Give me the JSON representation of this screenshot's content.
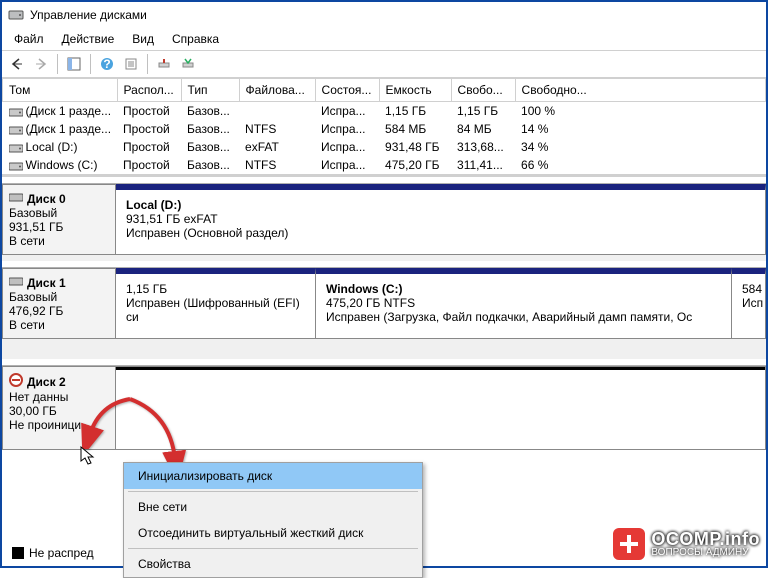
{
  "window": {
    "title": "Управление дисками"
  },
  "menu": {
    "file": "Файл",
    "action": "Действие",
    "view": "Вид",
    "help": "Справка"
  },
  "table": {
    "headers": [
      "Том",
      "Распол...",
      "Тип",
      "Файлова...",
      "Состоя...",
      "Емкость",
      "Свобо...",
      "Свободно..."
    ],
    "rows": [
      {
        "name": "(Диск 1 разде...",
        "layout": "Простой",
        "type": "Базов...",
        "fs": "",
        "status": "Испра...",
        "cap": "1,15 ГБ",
        "free": "1,15 ГБ",
        "pct": "100 %"
      },
      {
        "name": "(Диск 1 разде...",
        "layout": "Простой",
        "type": "Базов...",
        "fs": "NTFS",
        "status": "Испра...",
        "cap": "584 МБ",
        "free": "84 МБ",
        "pct": "14 %"
      },
      {
        "name": "Local (D:)",
        "layout": "Простой",
        "type": "Базов...",
        "fs": "exFAT",
        "status": "Испра...",
        "cap": "931,48 ГБ",
        "free": "313,68...",
        "pct": "34 %"
      },
      {
        "name": "Windows (C:)",
        "layout": "Простой",
        "type": "Базов...",
        "fs": "NTFS",
        "status": "Испра...",
        "cap": "475,20 ГБ",
        "free": "311,41...",
        "pct": "66 %"
      }
    ]
  },
  "disks": {
    "d0": {
      "title": "Диск 0",
      "type": "Базовый",
      "size": "931,51 ГБ",
      "status": "В сети",
      "p0": {
        "title": "Local  (D:)",
        "line2": "931,51 ГБ exFAT",
        "line3": "Исправен (Основной раздел)"
      }
    },
    "d1": {
      "title": "Диск 1",
      "type": "Базовый",
      "size": "476,92 ГБ",
      "status": "В сети",
      "p0": {
        "title": "",
        "line2": "1,15 ГБ",
        "line3": "Исправен (Шифрованный (EFI) си"
      },
      "p1": {
        "title": "Windows  (C:)",
        "line2": "475,20 ГБ NTFS",
        "line3": "Исправен (Загрузка, Файл подкачки, Аварийный дамп памяти, Ос"
      },
      "p2": {
        "title": "",
        "line2": "584",
        "line3": "Исп"
      }
    },
    "d2": {
      "title": "Диск 2",
      "type": "Нет данны",
      "size": "30,00 ГБ",
      "status": "Не проиници"
    }
  },
  "ctx": {
    "init": "Инициализировать диск",
    "offline": "Вне сети",
    "detach": "Отсоединить виртуальный жесткий диск",
    "props": "Свойства"
  },
  "legend": {
    "unallocated": "Не распред"
  },
  "brand": {
    "name": "OCOMP.info",
    "sub": "ВОПРОСЫ АДМИНУ"
  }
}
